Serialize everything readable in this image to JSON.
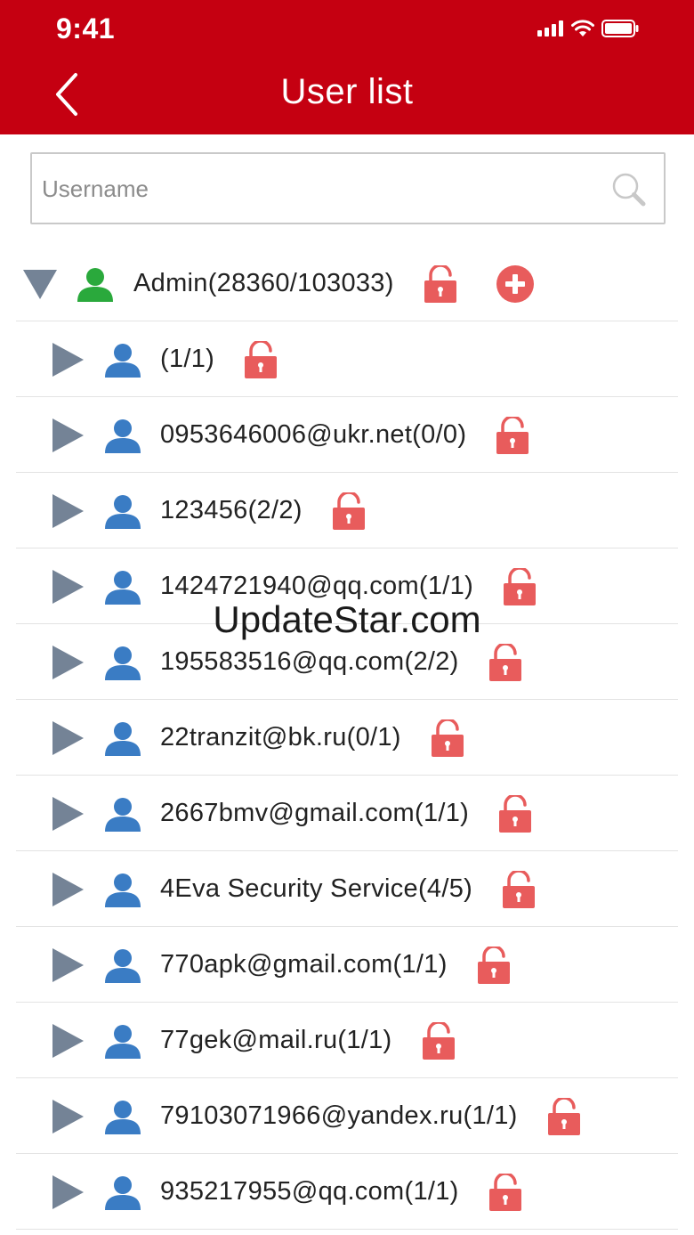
{
  "status_bar": {
    "time": "9:41"
  },
  "header": {
    "title": "User list",
    "bg_color": "#c50011"
  },
  "search": {
    "placeholder": "Username",
    "value": ""
  },
  "root": {
    "label": "Admin(28360/103033)",
    "icon_color": "#2aa93c"
  },
  "users": [
    {
      "label": "(1/1)"
    },
    {
      "label": "0953646006@ukr.net(0/0)"
    },
    {
      "label": "123456(2/2)"
    },
    {
      "label": "1424721940@qq.com(1/1)"
    },
    {
      "label": "195583516@qq.com(2/2)"
    },
    {
      "label": "22tranzit@bk.ru(0/1)"
    },
    {
      "label": "2667bmv@gmail.com(1/1)"
    },
    {
      "label": "4Eva Security Service(4/5)"
    },
    {
      "label": "770apk@gmail.com(1/1)"
    },
    {
      "label": "77gek@mail.ru(1/1)"
    },
    {
      "label": "79103071966@yandex.ru(1/1)"
    },
    {
      "label": "935217955@qq.com(1/1)"
    }
  ],
  "colors": {
    "user_icon": "#3a7cc4",
    "lock": "#e85c5c",
    "toggle": "#748396",
    "add": "#e85c5c"
  },
  "watermark": "UpdateStar.com"
}
